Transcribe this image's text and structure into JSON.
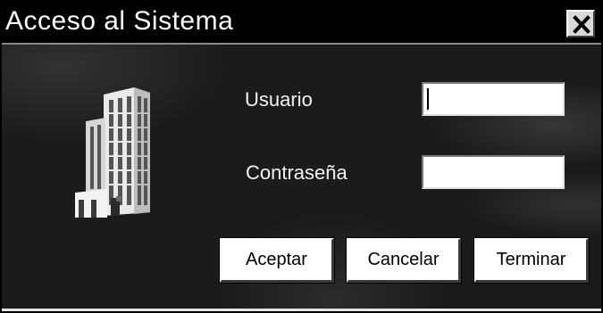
{
  "window": {
    "title": "Acceso al Sistema",
    "close_icon": "close-icon"
  },
  "graphic": {
    "icon": "building-icon"
  },
  "form": {
    "user_label": "Usuario",
    "user_value": "",
    "password_label": "Contraseña",
    "password_value": ""
  },
  "buttons": {
    "accept": "Aceptar",
    "cancel": "Cancelar",
    "exit": "Terminar"
  },
  "colors": {
    "background": "#1b1b1b",
    "titlebar": "#000000",
    "text": "#ffffff"
  }
}
